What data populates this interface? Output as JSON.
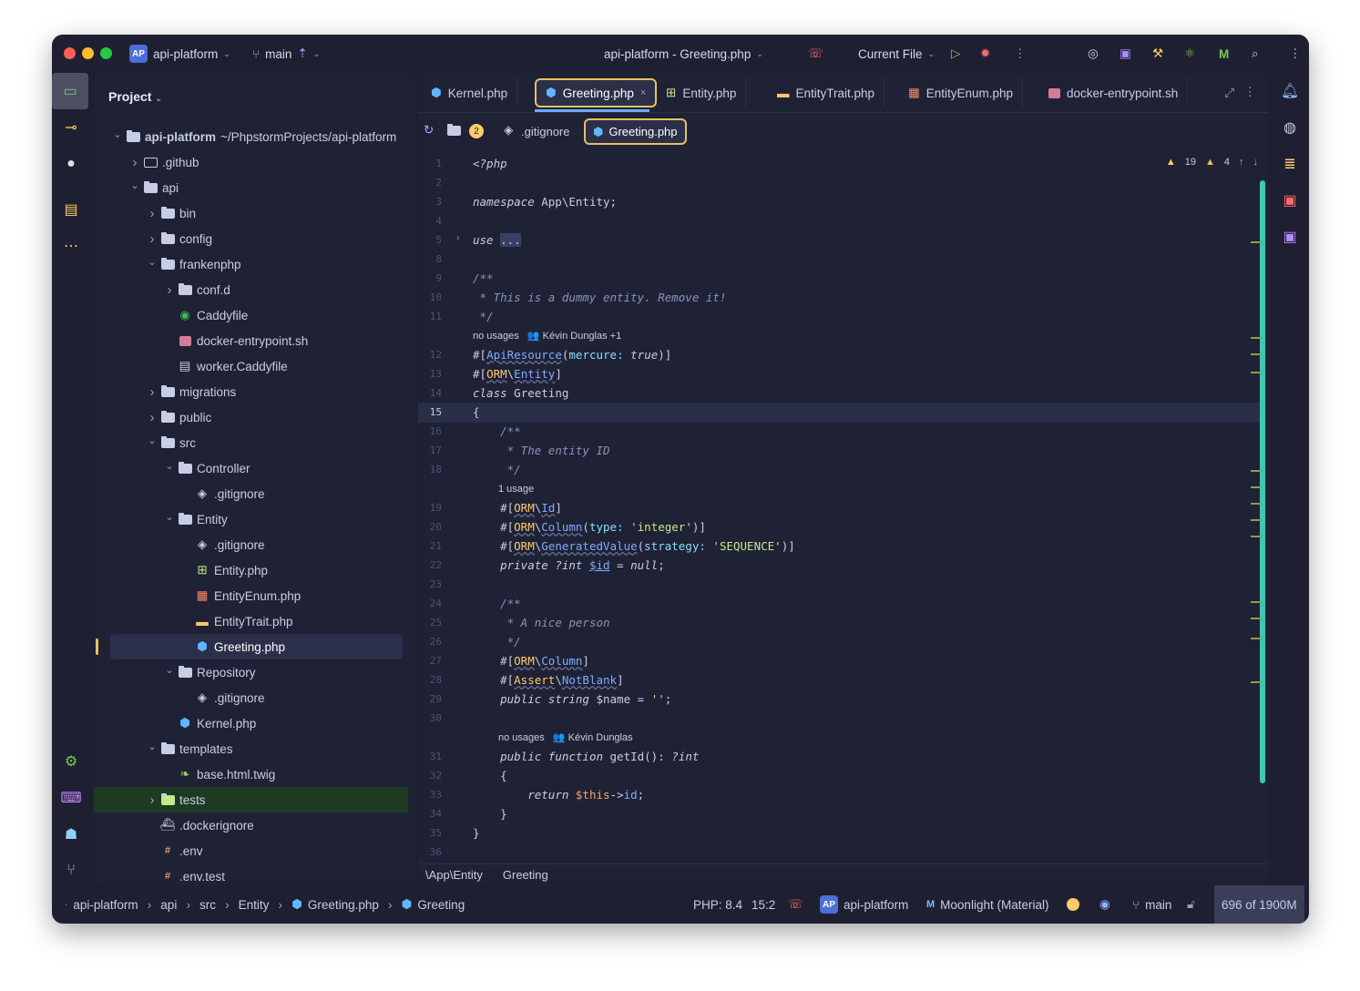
{
  "titlebar": {
    "project_chip": "AP",
    "project": "api-platform",
    "branch": "main",
    "window_title": "api-platform - Greeting.php",
    "run_config": "Current File"
  },
  "panel": {
    "title": "Project",
    "tree": [
      {
        "label": "api-platform",
        "extra": "~/PhpstormProjects/api-platform",
        "depth": 0,
        "chev": "down",
        "icon": "folder",
        "bold": true
      },
      {
        "label": ".github",
        "depth": 1,
        "chev": "right",
        "icon": "folder-outline"
      },
      {
        "label": "api",
        "depth": 1,
        "chev": "down",
        "icon": "folder"
      },
      {
        "label": "bin",
        "depth": 2,
        "chev": "right",
        "icon": "folder"
      },
      {
        "label": "config",
        "depth": 2,
        "chev": "right",
        "icon": "folder"
      },
      {
        "label": "frankenphp",
        "depth": 2,
        "chev": "down",
        "icon": "folder"
      },
      {
        "label": "conf.d",
        "depth": 3,
        "chev": "right",
        "icon": "folder"
      },
      {
        "label": "Caddyfile",
        "depth": 3,
        "chev": "",
        "icon": "caddy"
      },
      {
        "label": "docker-entrypoint.sh",
        "depth": 3,
        "chev": "",
        "icon": "shell"
      },
      {
        "label": "worker.Caddyfile",
        "depth": 3,
        "chev": "",
        "icon": "file"
      },
      {
        "label": "migrations",
        "depth": 2,
        "chev": "right",
        "icon": "folder"
      },
      {
        "label": "public",
        "depth": 2,
        "chev": "right",
        "icon": "folder"
      },
      {
        "label": "src",
        "depth": 2,
        "chev": "down",
        "icon": "folder"
      },
      {
        "label": "Controller",
        "depth": 3,
        "chev": "down",
        "icon": "folder"
      },
      {
        "label": ".gitignore",
        "depth": 4,
        "chev": "",
        "icon": "git"
      },
      {
        "label": "Entity",
        "depth": 3,
        "chev": "down",
        "icon": "folder"
      },
      {
        "label": ".gitignore",
        "depth": 4,
        "chev": "",
        "icon": "git"
      },
      {
        "label": "Entity.php",
        "depth": 4,
        "chev": "",
        "icon": "entity"
      },
      {
        "label": "EntityEnum.php",
        "depth": 4,
        "chev": "",
        "icon": "enum"
      },
      {
        "label": "EntityTrait.php",
        "depth": 4,
        "chev": "",
        "icon": "trait"
      },
      {
        "label": "Greeting.php",
        "depth": 4,
        "chev": "",
        "icon": "php",
        "selected": true
      },
      {
        "label": "Repository",
        "depth": 3,
        "chev": "down",
        "icon": "folder"
      },
      {
        "label": ".gitignore",
        "depth": 4,
        "chev": "",
        "icon": "git"
      },
      {
        "label": "Kernel.php",
        "depth": 3,
        "chev": "",
        "icon": "php"
      },
      {
        "label": "templates",
        "depth": 2,
        "chev": "down",
        "icon": "folder"
      },
      {
        "label": "base.html.twig",
        "depth": 3,
        "chev": "",
        "icon": "twig"
      },
      {
        "label": "tests",
        "depth": 2,
        "chev": "right",
        "icon": "folder-green",
        "highlight": true
      },
      {
        "label": ".dockerignore",
        "depth": 2,
        "chev": "",
        "icon": "docker"
      },
      {
        "label": ".env",
        "depth": 2,
        "chev": "",
        "icon": "env"
      },
      {
        "label": ".env.test",
        "depth": 2,
        "chev": "",
        "icon": "env"
      }
    ]
  },
  "tabs": [
    {
      "label": "Kernel.php",
      "icon": "php"
    },
    {
      "label": "Greeting.php",
      "icon": "php",
      "active": true
    },
    {
      "label": "Entity.php",
      "icon": "entity"
    },
    {
      "label": "EntityTrait.php",
      "icon": "trait"
    },
    {
      "label": "EntityEnum.php",
      "icon": "enum"
    },
    {
      "label": "docker-entrypoint.sh",
      "icon": "shell"
    }
  ],
  "subbar": {
    "badge": "2",
    "gitignore": ".gitignore",
    "active_file": "Greeting.php"
  },
  "inspections": {
    "warnings": "19",
    "weak_warnings": "4"
  },
  "code_lines": [
    {
      "n": "1",
      "html": "<span class='kw'>&lt;?php</span>"
    },
    {
      "n": "2",
      "html": ""
    },
    {
      "n": "3",
      "html": "<span class='kw'>namespace</span> App\\Entity;"
    },
    {
      "n": "4",
      "html": ""
    },
    {
      "n": "5",
      "html": "<span class='kw'>use</span> <span style='background:#3a3f66;color:#c8cde6'>...</span>"
    },
    {
      "n": "8",
      "html": ""
    },
    {
      "n": "9",
      "html": "<span class='cm'>/**</span>"
    },
    {
      "n": "10",
      "html": "<span class='cm'> * This is a dummy entity. Remove it!</span>"
    },
    {
      "n": "11",
      "html": "<span class='cm'> */</span>"
    },
    {
      "n": "",
      "hint": "no usages   👥 Kévin Dunglas +1"
    },
    {
      "n": "12",
      "html": "#[<span class='attr'>ApiResource</span>(<span class='par'>mercure:</span> <span class='kw'>true</span>)]"
    },
    {
      "n": "13",
      "html": "#[<span class='orm'>ORM</span>\\<span class='attr'>Entity</span>]"
    },
    {
      "n": "14",
      "html": "<span class='kw'>class</span> Greeting"
    },
    {
      "n": "15",
      "html": "{"
    },
    {
      "n": "16",
      "html": "    <span class='cm'>/**</span>"
    },
    {
      "n": "17",
      "html": "    <span class='cm'> * The entity ID</span>"
    },
    {
      "n": "18",
      "html": "    <span class='cm'> */</span>"
    },
    {
      "n": "",
      "hint": "1 usage",
      "indent": true
    },
    {
      "n": "19",
      "html": "    #[<span class='orm'>ORM</span>\\<span class='attr'>Id</span>]"
    },
    {
      "n": "20",
      "html": "    #[<span class='orm'>ORM</span>\\<span class='attr'>Column</span>(<span class='par'>type:</span> <span class='str'>'integer'</span>)]"
    },
    {
      "n": "21",
      "html": "    #[<span class='orm'>ORM</span>\\<span class='attr'>GeneratedValue</span>(<span class='par'>strategy:</span> <span class='str'>'SEQUENCE'</span>)]"
    },
    {
      "n": "22",
      "html": "    <span class='kw'>private ?int</span> <span class='var' style='text-decoration:underline'>$id</span> = <span class='kw'>null</span>;"
    },
    {
      "n": "23",
      "html": ""
    },
    {
      "n": "24",
      "html": "    <span class='cm'>/**</span>"
    },
    {
      "n": "25",
      "html": "    <span class='cm'> * A nice person</span>"
    },
    {
      "n": "26",
      "html": "    <span class='cm'> */</span>"
    },
    {
      "n": "27",
      "html": "    #[<span class='orm'>ORM</span>\\<span class='attr'>Column</span>]"
    },
    {
      "n": "28",
      "html": "    #[<span class='orm'>Assert</span>\\<span class='attr'>NotBlank</span>]"
    },
    {
      "n": "29",
      "html": "    <span class='kw'>public string</span> $name = <span class='str'>''</span>;"
    },
    {
      "n": "30",
      "html": ""
    },
    {
      "n": "",
      "hint": "no usages   👥 Kévin Dunglas",
      "indent": true
    },
    {
      "n": "31",
      "html": "    <span class='kw'>public function</span> getId(): <span class='kw'>?int</span>"
    },
    {
      "n": "32",
      "html": "    {"
    },
    {
      "n": "33",
      "html": "        <span class='kw'>return</span> <span class='num'>$this</span>-&gt;<span class='var'>id</span>;"
    },
    {
      "n": "34",
      "html": "    }"
    },
    {
      "n": "35",
      "html": "}"
    },
    {
      "n": "36",
      "html": ""
    }
  ],
  "editor_breadcrumb": {
    "namespace": "\\App\\Entity",
    "class": "Greeting"
  },
  "statusbar": {
    "crumbs": [
      "api-platform",
      "api",
      "src",
      "Entity",
      "Greeting.php",
      "Greeting"
    ],
    "php": "PHP: 8.4",
    "pos": "15:2",
    "project_chip": "AP",
    "project": "api-platform",
    "theme": "Moonlight (Material)",
    "branch": "main",
    "memory": "696 of 1900M"
  },
  "colors": {
    "background": "#1e2032",
    "panel": "#1f2235",
    "accent": "#e8c060",
    "selection": "#2a2e46"
  }
}
